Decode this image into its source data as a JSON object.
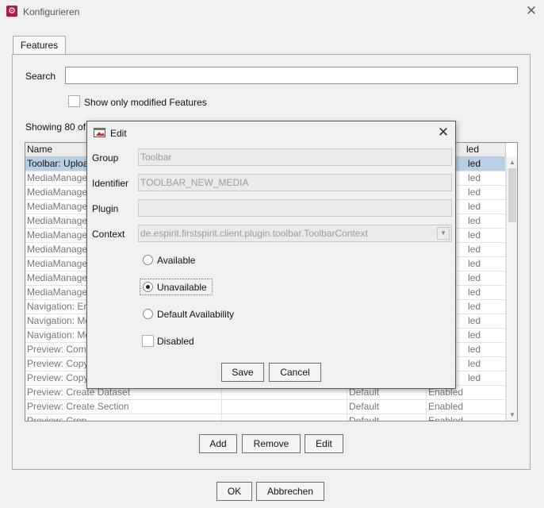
{
  "window": {
    "title": "Konfigurieren",
    "close_glyph": "✕",
    "icon": "gear-icon"
  },
  "tabs": {
    "features": "Features"
  },
  "search": {
    "label": "Search",
    "value": ""
  },
  "filter": {
    "show_modified_label": "Show only modified Features",
    "checked": false
  },
  "showing_text": "Showing 80 of",
  "table": {
    "columns": [
      "Name",
      "",
      "",
      "led"
    ],
    "rows": [
      [
        "Toolbar: Uploa",
        "",
        "",
        "led"
      ],
      [
        "MediaManage",
        "",
        "",
        "led"
      ],
      [
        "MediaManage",
        "",
        "",
        "led"
      ],
      [
        "MediaManage",
        "",
        "",
        "led"
      ],
      [
        "MediaManage",
        "",
        "",
        "led"
      ],
      [
        "MediaManage",
        "",
        "",
        "led"
      ],
      [
        "MediaManage",
        "",
        "",
        "led"
      ],
      [
        "MediaManage",
        "",
        "",
        "led"
      ],
      [
        "MediaManage",
        "",
        "",
        "led"
      ],
      [
        "MediaManage",
        "",
        "",
        "led"
      ],
      [
        "Navigation: En",
        "",
        "",
        "led"
      ],
      [
        "Navigation: Mo",
        "",
        "",
        "led"
      ],
      [
        "Navigation: Mo",
        "",
        "",
        "led"
      ],
      [
        "Preview: Comr",
        "",
        "",
        "led"
      ],
      [
        "Preview: Copy",
        "",
        "",
        "led"
      ],
      [
        "Preview: Copy",
        "",
        "",
        "led"
      ],
      [
        "Preview: Create Dataset",
        "",
        "Default",
        "Enabled"
      ],
      [
        "Preview: Create Section",
        "",
        "Default",
        "Enabled"
      ],
      [
        "Preview: Crop",
        "",
        "Default",
        "Enabled"
      ]
    ]
  },
  "buttons": {
    "add": "Add",
    "remove": "Remove",
    "edit": "Edit",
    "ok": "OK",
    "cancel": "Abbrechen"
  },
  "dialog": {
    "title": "Edit",
    "close_glyph": "✕",
    "group_label": "Group",
    "group_value": "Toolbar",
    "identifier_label": "Identifier",
    "identifier_value": "TOOLBAR_NEW_MEDIA",
    "plugin_label": "Plugin",
    "plugin_value": "",
    "context_label": "Context",
    "context_value": "de.espirit.firstspirit.client.plugin.toolbar.ToolbarContext",
    "options": {
      "available": "Available",
      "unavailable": "Unavailable",
      "default": "Default Availability"
    },
    "selected_option": "unavailable",
    "disabled_label": "Disabled",
    "disabled_checked": false,
    "save": "Save",
    "cancel": "Cancel"
  },
  "colors": {
    "selection": "#b8cfe5",
    "app_icon": "#b0174f"
  }
}
